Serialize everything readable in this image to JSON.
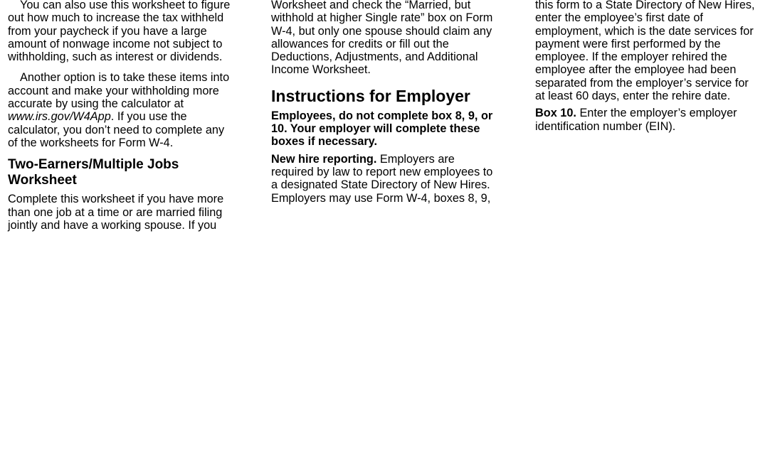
{
  "column1": {
    "para1_lines": [
      "You can also use this worksheet to figure",
      "out how much to increase the tax withheld",
      "from your paycheck if you have a large",
      "amount of nonwage income not subject to",
      "withholding, such as interest or dividends."
    ],
    "para2": {
      "line1": "Another option is to take these items into",
      "line2": "account and make your withholding more",
      "line3": "accurate by using the calculator at",
      "link": "www.irs.gov/W4App",
      "line4_after": ". If you use the",
      "line5": "calculator, you don’t need to complete any",
      "line6": "of the worksheets for Form W-4."
    },
    "heading_lines": [
      "Two-Earners/Multiple Jobs",
      "Worksheet"
    ],
    "para3_lines": [
      "Complete this worksheet if you have more",
      "than one job at a time or are married filing",
      "jointly and have a working spouse. If you"
    ]
  },
  "column2": {
    "para1_lines": [
      "Worksheet and check the “Married, but",
      "withhold at higher Single rate” box on Form",
      "W-4, but only one spouse should claim any",
      "allowances for credits or fill out the",
      "Deductions, Adjustments, and Additional",
      "Income Worksheet."
    ],
    "heading": "Instructions for Employer",
    "bold_para_lines": [
      "Employees, do not complete box 8, 9, or",
      "10. Your employer will complete these",
      "boxes if necessary."
    ],
    "new_hire": {
      "label": "New hire reporting.",
      "line1_after": " Employers are",
      "line2": "required by law to report new employees to",
      "line3": "a designated State Directory of New Hires.",
      "line4": "Employers may use Form W-4, boxes 8, 9,"
    }
  },
  "column3": {
    "para1_lines": [
      "this form to a State Directory of New Hires,",
      "enter the employee’s first date of",
      "employment, which is the date services for",
      "payment were first performed by the",
      "employee. If the employer rehired the",
      "employee after the employee had been",
      "separated from the employer’s service for",
      "at least 60 days, enter the rehire date."
    ],
    "box10": {
      "label": "Box 10.",
      "line1_after": " Enter the employer’s employer",
      "line2": "identification number (EIN)."
    }
  }
}
